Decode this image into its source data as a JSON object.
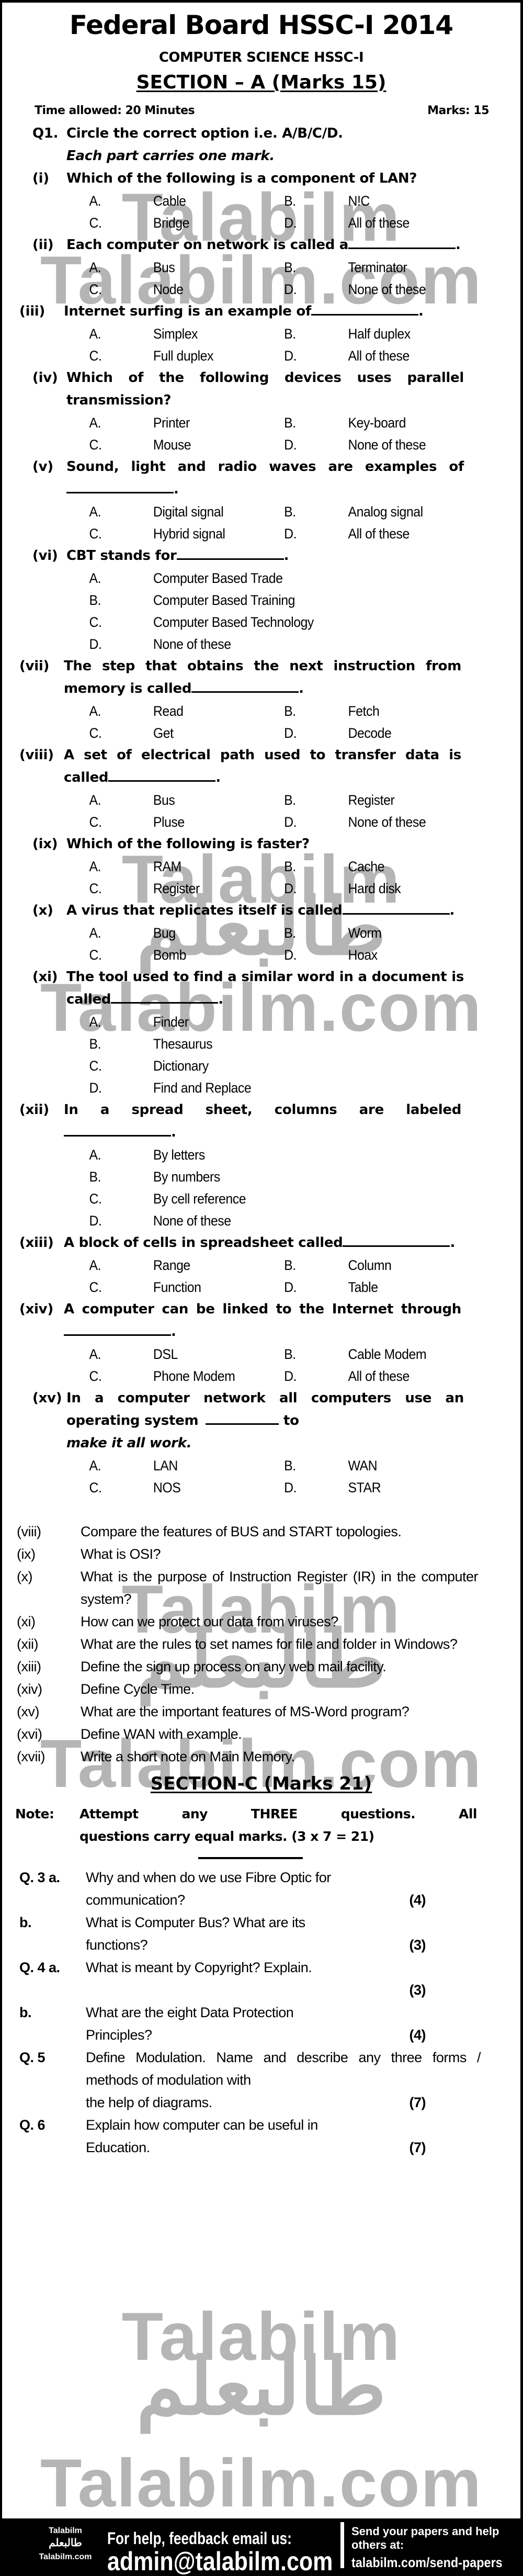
{
  "header": {
    "title": "Federal Board HSSC-I 2014",
    "subtitle": "COMPUTER SCIENCE HSSC-I",
    "section_a": "SECTION – A (Marks 15)",
    "time_allowed": "Time allowed: 20 Minutes",
    "marks": "Marks: 15"
  },
  "watermark": {
    "latin": "Talabilm",
    "latin_com": "Talabilm.com",
    "urdu": "طالبعلم"
  },
  "q1": {
    "num": "Q1.",
    "instruction_line1": "Circle the correct option i.e. A/B/C/D.",
    "instruction_line2": "Each part carries one mark."
  },
  "mcqs": [
    {
      "num": "(i)",
      "text": "Which of the following is a component of LAN?",
      "blank": false,
      "options": [
        [
          "A.",
          "Cable"
        ],
        [
          "B.",
          "N!C"
        ],
        [
          "C.",
          "Bridge"
        ],
        [
          "D.",
          "All of these"
        ]
      ],
      "layout": "grid"
    },
    {
      "num": "(ii)",
      "text": "Each computer on network is called a",
      "blank": true,
      "after": ".",
      "options": [
        [
          "A.",
          "Bus"
        ],
        [
          "B.",
          "Terminator"
        ],
        [
          "C.",
          "Node"
        ],
        [
          "D.",
          "None of these"
        ]
      ],
      "layout": "grid"
    },
    {
      "num": "(iii)",
      "text": "Internet surfing is an example of",
      "blank": true,
      "after": ".",
      "options": [
        [
          "A.",
          "Simplex"
        ],
        [
          "B.",
          "Half duplex"
        ],
        [
          "C.",
          "Full duplex"
        ],
        [
          "D.",
          "All of these"
        ]
      ],
      "layout": "grid"
    },
    {
      "num": "(iv)",
      "text": "Which of the following devices uses parallel transmission?",
      "blank": false,
      "options": [
        [
          "A.",
          "Printer"
        ],
        [
          "B.",
          "Key-board"
        ],
        [
          "C.",
          "Mouse"
        ],
        [
          "D.",
          "None of these"
        ]
      ],
      "layout": "grid"
    },
    {
      "num": "(v)",
      "text": "Sound, light and radio waves are examples of",
      "blank": true,
      "after": ".",
      "options": [
        [
          "A.",
          "Digital signal"
        ],
        [
          "B.",
          "Analog signal"
        ],
        [
          "C.",
          "Hybrid signal"
        ],
        [
          "D.",
          "All of these"
        ]
      ],
      "layout": "grid"
    },
    {
      "num": "(vi)",
      "text": "CBT stands for",
      "blank": true,
      "after": ".",
      "options": [
        [
          "A.",
          "Computer Based Trade"
        ],
        [
          "B.",
          "Computer Based Training"
        ],
        [
          "C.",
          "Computer Based Technology"
        ],
        [
          "D.",
          "None of these"
        ]
      ],
      "layout": "list"
    },
    {
      "num": "(vii)",
      "text": "The step that obtains the next instruction from memory is called",
      "blank": true,
      "after": ".",
      "options": [
        [
          "A.",
          "Read"
        ],
        [
          "B.",
          "Fetch"
        ],
        [
          "C.",
          "Get"
        ],
        [
          "D.",
          "Decode"
        ]
      ],
      "layout": "grid"
    },
    {
      "num": "(viii)",
      "text": "A set of electrical path used to transfer data is called",
      "blank": true,
      "after": ".",
      "options": [
        [
          "A.",
          "Bus"
        ],
        [
          "B.",
          "Register"
        ],
        [
          "C.",
          "Pluse"
        ],
        [
          "D.",
          "None of these"
        ]
      ],
      "layout": "grid"
    },
    {
      "num": "(ix)",
      "text": "Which of the following is faster?",
      "blank": false,
      "options": [
        [
          "A.",
          "RAM"
        ],
        [
          "B.",
          "Cache"
        ],
        [
          "C.",
          "Register"
        ],
        [
          "D.",
          "Hard disk"
        ]
      ],
      "layout": "grid"
    },
    {
      "num": "(x)",
      "text": "A virus that replicates itself is called",
      "blank": true,
      "after": ".",
      "options": [
        [
          "A.",
          "Bug"
        ],
        [
          "B.",
          "Worm"
        ],
        [
          "C.",
          "Bomb"
        ],
        [
          "D.",
          "Hoax"
        ]
      ],
      "layout": "grid"
    },
    {
      "num": "(xi)",
      "text": "The tool used to find a similar word in a document is called",
      "blank": true,
      "after": ".",
      "options": [
        [
          "A.",
          "Finder"
        ],
        [
          "B.",
          "Thesaurus"
        ],
        [
          "C.",
          "Dictionary"
        ],
        [
          "D.",
          "Find and Replace"
        ]
      ],
      "layout": "list"
    },
    {
      "num": "(xii)",
      "text": "In a spread sheet, columns are labeled",
      "blank": true,
      "after": ".",
      "options": [
        [
          "A.",
          "By letters"
        ],
        [
          "B.",
          "By numbers"
        ],
        [
          "C.",
          "By cell reference"
        ],
        [
          "D.",
          "None of these"
        ]
      ],
      "layout": "list"
    },
    {
      "num": "(xiii)",
      "text": "A block of cells in spreadsheet called",
      "blank": true,
      "after": ".",
      "options": [
        [
          "A.",
          "Range"
        ],
        [
          "B.",
          "Column"
        ],
        [
          "C.",
          "Function"
        ],
        [
          "D.",
          "Table"
        ]
      ],
      "layout": "grid"
    },
    {
      "num": "(xiv)",
      "text": "A computer can be linked to the Internet through",
      "blank": true,
      "after": ".",
      "options": [
        [
          "A.",
          "DSL"
        ],
        [
          "B.",
          "Cable Modem"
        ],
        [
          "C.",
          "Phone Modem"
        ],
        [
          "D.",
          "All of these"
        ]
      ],
      "layout": "grid"
    },
    {
      "num": "(xv)",
      "text": "In a computer network all computers use an operating system",
      "blank": true,
      "after": " to",
      "tail_italic": "make it all work.",
      "options": [
        [
          "A.",
          "LAN"
        ],
        [
          "B.",
          "WAN"
        ],
        [
          "C.",
          "NOS"
        ],
        [
          "D.",
          "STAR"
        ]
      ],
      "layout": "grid"
    }
  ],
  "section_b": [
    {
      "num": "(viii)",
      "text": "Compare the features of BUS and START topologies."
    },
    {
      "num": "(ix)",
      "text": "What is OSI?"
    },
    {
      "num": "(x)",
      "text": "What is the purpose of Instruction Register (IR) in the computer system?"
    },
    {
      "num": "(xi)",
      "text": "How can we protect our data from viruses?"
    },
    {
      "num": "(xii)",
      "text": "What are the rules to set names for file and folder in Windows?"
    },
    {
      "num": "(xiii)",
      "text": "Define the sign up process on any web mail facility."
    },
    {
      "num": "(xiv)",
      "text": "Define Cycle Time."
    },
    {
      "num": "(xv)",
      "text": "What are the important features of MS-Word program?"
    },
    {
      "num": "(xvi)",
      "text": "Define WAN with example."
    },
    {
      "num": "(xvii)",
      "text": "Write a short note on Main Memory."
    }
  ],
  "section_c": {
    "heading": "SECTION-C (Marks 21)",
    "note_label": "Note:",
    "note_line1": "Attempt any THREE questions. All",
    "note_line2": "questions carry equal marks. (3 x 7 = 21)",
    "questions": [
      {
        "num": "Q. 3 a.",
        "line1": "Why and when do we use Fibre Optic for",
        "last": "communication?",
        "marks": "(4)"
      },
      {
        "num": "b.",
        "line1": "What is Computer Bus? What are its",
        "last": "functions?",
        "marks": "(3)"
      },
      {
        "num": "Q. 4 a.",
        "line1": "What is meant by Copyright? Explain.",
        "last": "",
        "marks": "(3)"
      },
      {
        "num": "b.",
        "line1": "What are the eight Data Protection",
        "last": "Principles?",
        "marks": "(4)"
      },
      {
        "num": "Q. 5",
        "line1": "Define Modulation. Name and describe any three forms / methods of modulation with",
        "last": "the help of diagrams.",
        "marks": "(7)"
      },
      {
        "num": "Q. 6",
        "line1": "Explain how computer can be useful in",
        "last": "Education.",
        "marks": "(7)"
      }
    ]
  },
  "footer": {
    "brand": "Talabilm",
    "brand_urdu": "طالبعلم",
    "brand_site": "Talabilm.com",
    "help_line": "For help, feedback email us:",
    "email": "admin@talabilm.com",
    "send_line1": "Send your papers and help",
    "send_line2": "others at:",
    "send_url": "talabilm.com/send-papers"
  }
}
